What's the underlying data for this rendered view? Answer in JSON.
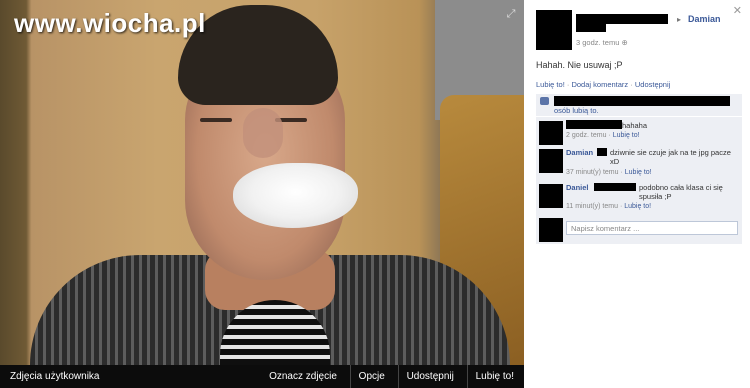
{
  "watermark": "www.wiocha.pl",
  "photo_bar": {
    "owner_label": "Zdjęcia użytkownika",
    "tag_label": "Oznacz zdjęcie",
    "options_label": "Opcje",
    "share_label": "Udostępnij",
    "like_label": "Lubię to!"
  },
  "post": {
    "to_name": "Damian",
    "time": "3 godz. temu",
    "text": "Hahah. Nie usuwaj ;P",
    "actions": {
      "like": "Lubię to!",
      "comment": "Dodaj komentarz",
      "share": "Udostępnij"
    },
    "likes_text": "osób lubią to."
  },
  "comments": [
    {
      "author": "",
      "text": "hahaha",
      "time": "2 godz. temu",
      "like": "Lubię to!"
    },
    {
      "author": "Damian",
      "text": "dziwnie sie czuje jak na te jpg pacze xD",
      "time": "37 minut(y) temu",
      "like": "Lubię to!"
    },
    {
      "author": "Daniel",
      "text": "podobno cała klasa ci się spusiła ;P",
      "time": "11 minut(y) temu",
      "like": "Lubię to!"
    }
  ],
  "write_comment": {
    "placeholder": "Napisz komentarz ..."
  },
  "icons": {
    "close": "close-icon",
    "expand": "expand-icon",
    "like": "thumbs-up-icon",
    "globe": "globe-icon"
  },
  "colors": {
    "link": "#3b5998",
    "panel_bg": "#edeff4",
    "photo_bar_bg": "#0c0c0c"
  }
}
